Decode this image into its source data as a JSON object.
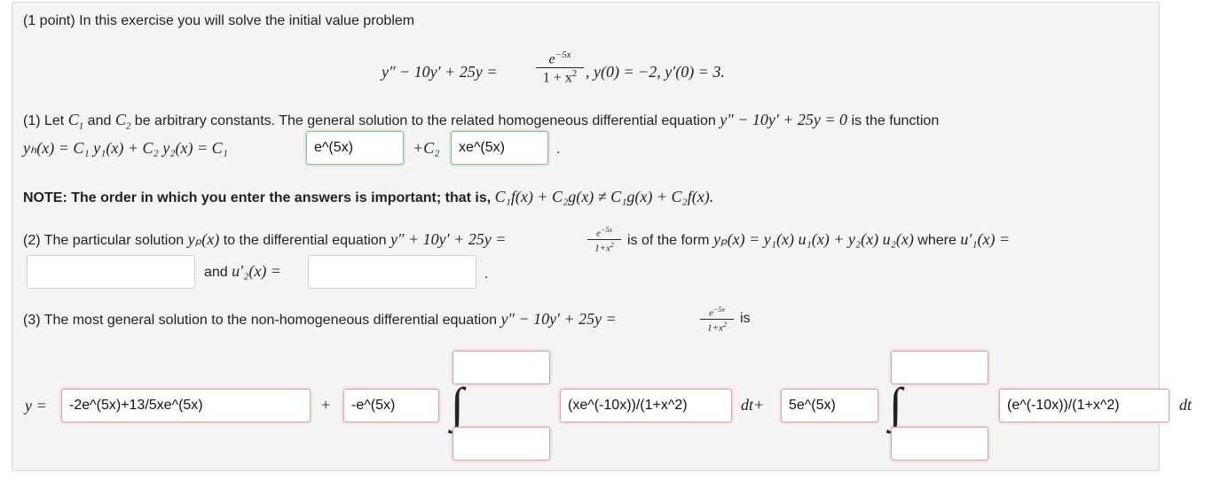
{
  "intro": "(1 point) In this exercise you will solve the initial value problem",
  "ivp": {
    "lhs": "y″ − 10y′ + 25y =",
    "rhs_num": "e",
    "rhs_num_exp": "−5x",
    "rhs_den": "1 + x",
    "rhs_den_exp": "2",
    "conditions": ",   y(0) = −2,   y′(0) = 3."
  },
  "part1": {
    "text_a": "(1) Let",
    "c1": "C",
    "c1_sub": "1",
    "and": "and",
    "c2": "C",
    "c2_sub": "2",
    "text_b": "be arbitrary constants. The general solution to the related homogeneous differential equation",
    "hom_eq": "y″ − 10y′ + 25y = 0",
    "text_c": "is the function",
    "yh_expr": "yₕ(x) = C₁ y₁(x) + C₂ y₂(x) = C₁",
    "plus_c2": "+C₂",
    "answer1": "e^(5x)",
    "answer2": "xe^(5x)",
    "period": "."
  },
  "note": {
    "bold": "NOTE: The order in which you enter the answers is important; that is,",
    "math": "C₁f(x) + C₂g(x) ≠ C₁g(x) + C₂f(x)."
  },
  "part2": {
    "text_a": "(2) The particular solution",
    "yp": "yₚ(x)",
    "text_b": "to the differential equation",
    "eq": "y″ + 10y′ + 25y =",
    "frac_num": "e",
    "frac_num_exp": "−5x",
    "frac_den": "1+x",
    "frac_den_exp": "2",
    "text_c": "is of the form",
    "form": "yₚ(x) = y₁(x) u₁(x) + y₂(x) u₂(x)",
    "where": "where",
    "u1p": "u′₁(x) =",
    "and": "and",
    "u2p": "u′₂(x) =",
    "answer_u1": "",
    "answer_u2": "",
    "period": "."
  },
  "part3": {
    "text_a": "(3) The most general solution to the non-homogeneous differential equation",
    "eq": "y″ − 10y′ + 25y =",
    "frac_num": "e",
    "frac_num_exp": "−5x",
    "frac_den": "1+x",
    "frac_den_exp": "2",
    "is": "is",
    "y_eq": "y =",
    "plus": "+",
    "dt_plus": "dt+",
    "dt": "dt",
    "integral": "∫",
    "answer_main": "-2e^(5x)+13/5xe^(5x)",
    "answer_coef1": "-e^(5x)",
    "answer_int1_upper": "",
    "answer_int1_lower": "",
    "answer_integrand1": "(xe^(-10x))/(1+x^2)",
    "answer_coef2": "5e^(5x)",
    "answer_int2_upper": "",
    "answer_int2_lower": "",
    "answer_integrand2": "(e^(-10x))/(1+x^2)"
  }
}
